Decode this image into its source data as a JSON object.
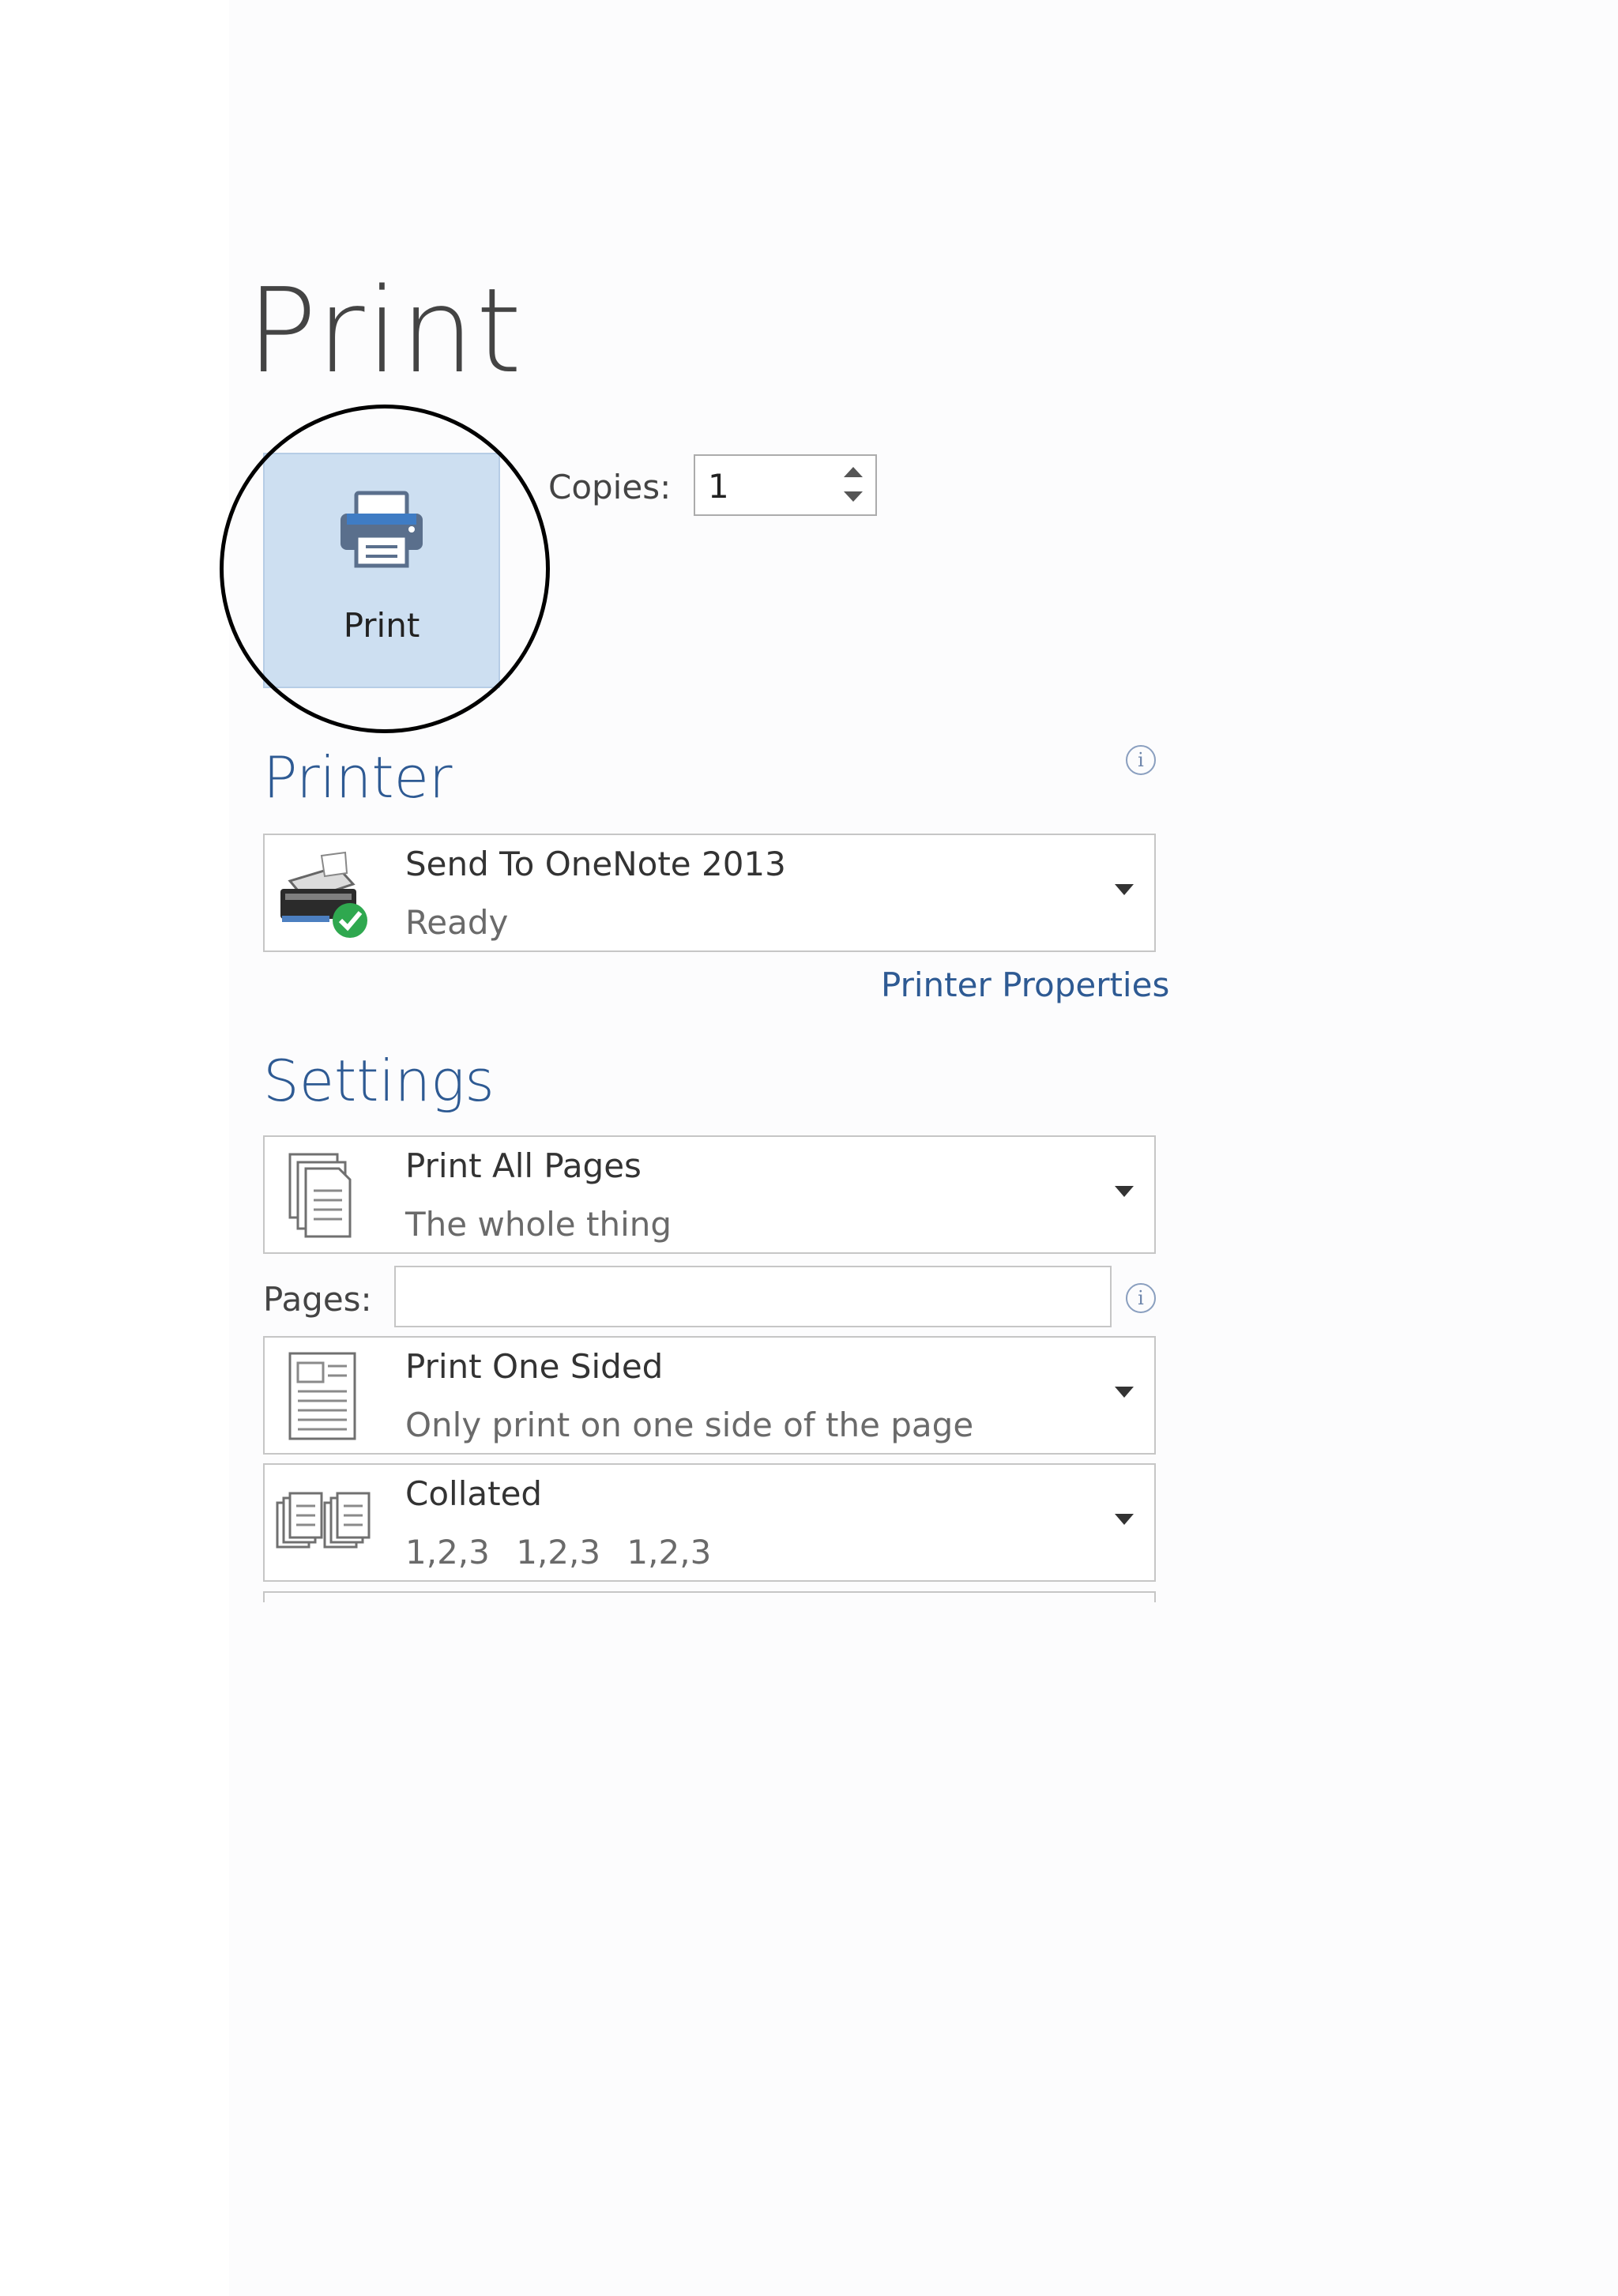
{
  "page": {
    "title": "Print"
  },
  "print_button": {
    "label": "Print",
    "icon": "printer-icon"
  },
  "copies": {
    "label": "Copies:",
    "value": "1"
  },
  "printer_section": {
    "heading": "Printer",
    "info_icon": "info-icon",
    "selected_printer": {
      "name": "Send To OneNote 2013",
      "status": "Ready",
      "icon": "printer-ready-icon"
    },
    "properties_link": "Printer Properties"
  },
  "settings_section": {
    "heading": "Settings",
    "pages_range": {
      "title": "Print All Pages",
      "subtitle": "The whole thing",
      "icon": "pages-stack-icon"
    },
    "pages_field": {
      "label": "Pages:",
      "value": "",
      "info_icon": "info-icon"
    },
    "sides": {
      "title": "Print One Sided",
      "subtitle": "Only print on one side of the page",
      "icon": "one-sided-page-icon"
    },
    "collation": {
      "title": "Collated",
      "subtitle": "1,2,3    1,2,3    1,2,3",
      "icon": "collated-icon"
    }
  },
  "colors": {
    "accent": "#2e5a93",
    "print_button_bg": "#cddff1",
    "annotation_circle": "#000000"
  }
}
